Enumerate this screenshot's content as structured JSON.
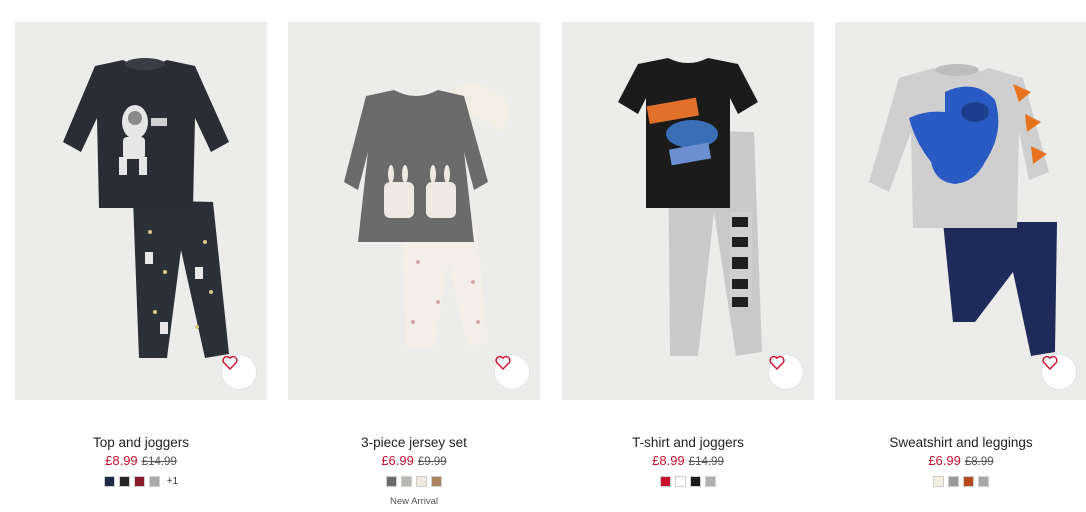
{
  "products": [
    {
      "name": "Top and joggers",
      "price": "£8.99",
      "old_price": "£14.99",
      "swatches": [
        "#1f2a44",
        "#262626",
        "#8a1c2b",
        "#a9a9a9"
      ],
      "more_colors": "+1",
      "badge": ""
    },
    {
      "name": "3-piece jersey set",
      "price": "£6.99",
      "old_price": "£9.99",
      "swatches": [
        "#6b6b6b",
        "#b8b6b0",
        "#efe9dd",
        "#a8845e"
      ],
      "more_colors": "",
      "badge": "New Arrival"
    },
    {
      "name": "T-shirt and joggers",
      "price": "£8.99",
      "old_price": "£14.99",
      "swatches": [
        "#c8102e",
        "#ffffff",
        "#1a1a1a",
        "#b0b0b0"
      ],
      "more_colors": "",
      "badge": ""
    },
    {
      "name": "Sweatshirt and leggings",
      "price": "£6.99",
      "old_price": "£8.99",
      "swatches": [
        "#f2eee0",
        "#9a9a9a",
        "#b54a1e",
        "#a9a9a9"
      ],
      "more_colors": "",
      "badge": ""
    }
  ],
  "icons": {
    "favorite": "heart-icon"
  },
  "colors": {
    "sale_price": "#c8102e",
    "image_background": "#ececea"
  }
}
